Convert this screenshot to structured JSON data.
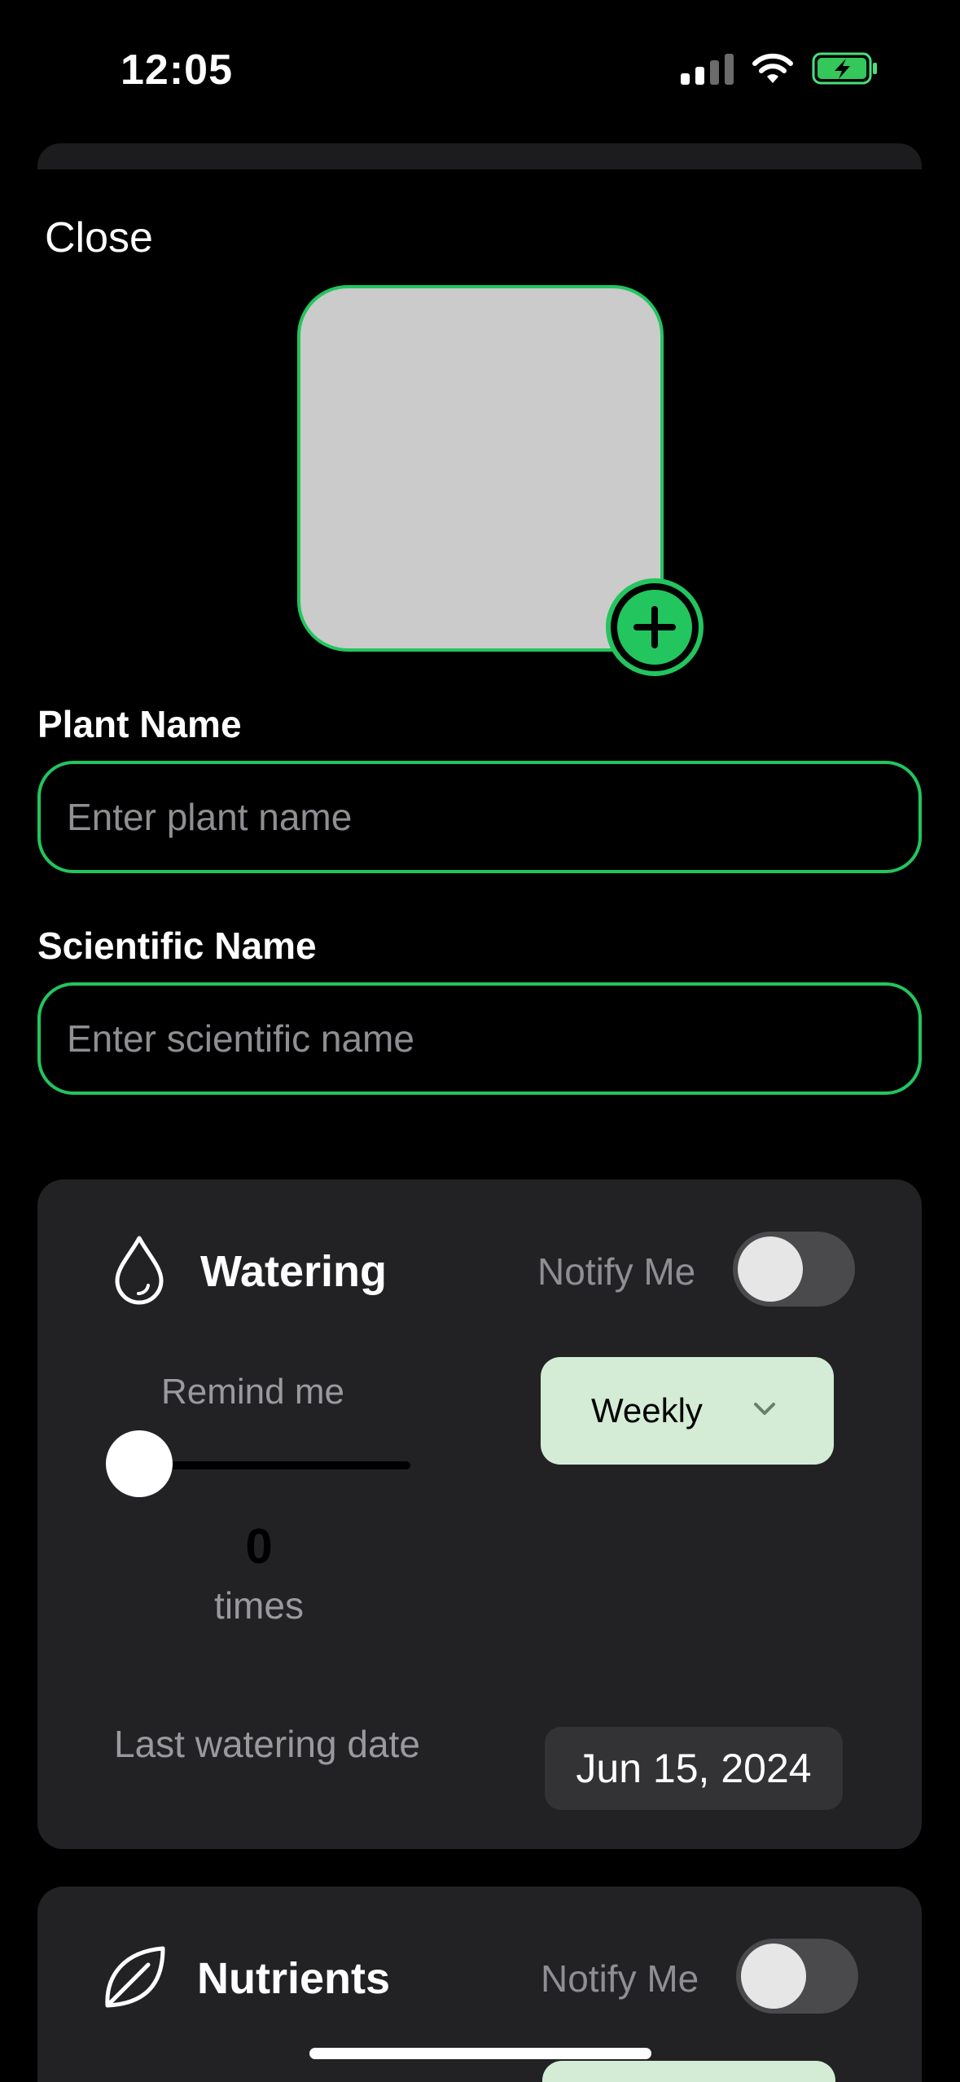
{
  "status_bar": {
    "time": "12:05",
    "icons": [
      "cellular-signal-icon",
      "wifi-icon",
      "battery-charging-icon"
    ]
  },
  "header": {
    "close_label": "Close"
  },
  "photo": {
    "add_icon": "plus-circle-icon"
  },
  "form": {
    "plant_name": {
      "label": "Plant Name",
      "placeholder": "Enter plant name",
      "value": ""
    },
    "scientific_name": {
      "label": "Scientific Name",
      "placeholder": "Enter scientific name",
      "value": ""
    }
  },
  "watering": {
    "icon": "water-drop-icon",
    "title": "Watering",
    "notify_label": "Notify Me",
    "notify_enabled": false,
    "remind_label": "Remind me",
    "remind_count": "0",
    "remind_unit": "times",
    "frequency": "Weekly",
    "last_date_label": "Last watering date",
    "last_date": "Jun 15, 2024"
  },
  "nutrients": {
    "icon": "leaf-icon",
    "title": "Nutrients",
    "notify_label": "Notify Me",
    "notify_enabled": false
  },
  "colors": {
    "accent": "#22c55e",
    "card_bg": "#222224",
    "select_bg": "#d4ecd6",
    "background": "#000000"
  }
}
